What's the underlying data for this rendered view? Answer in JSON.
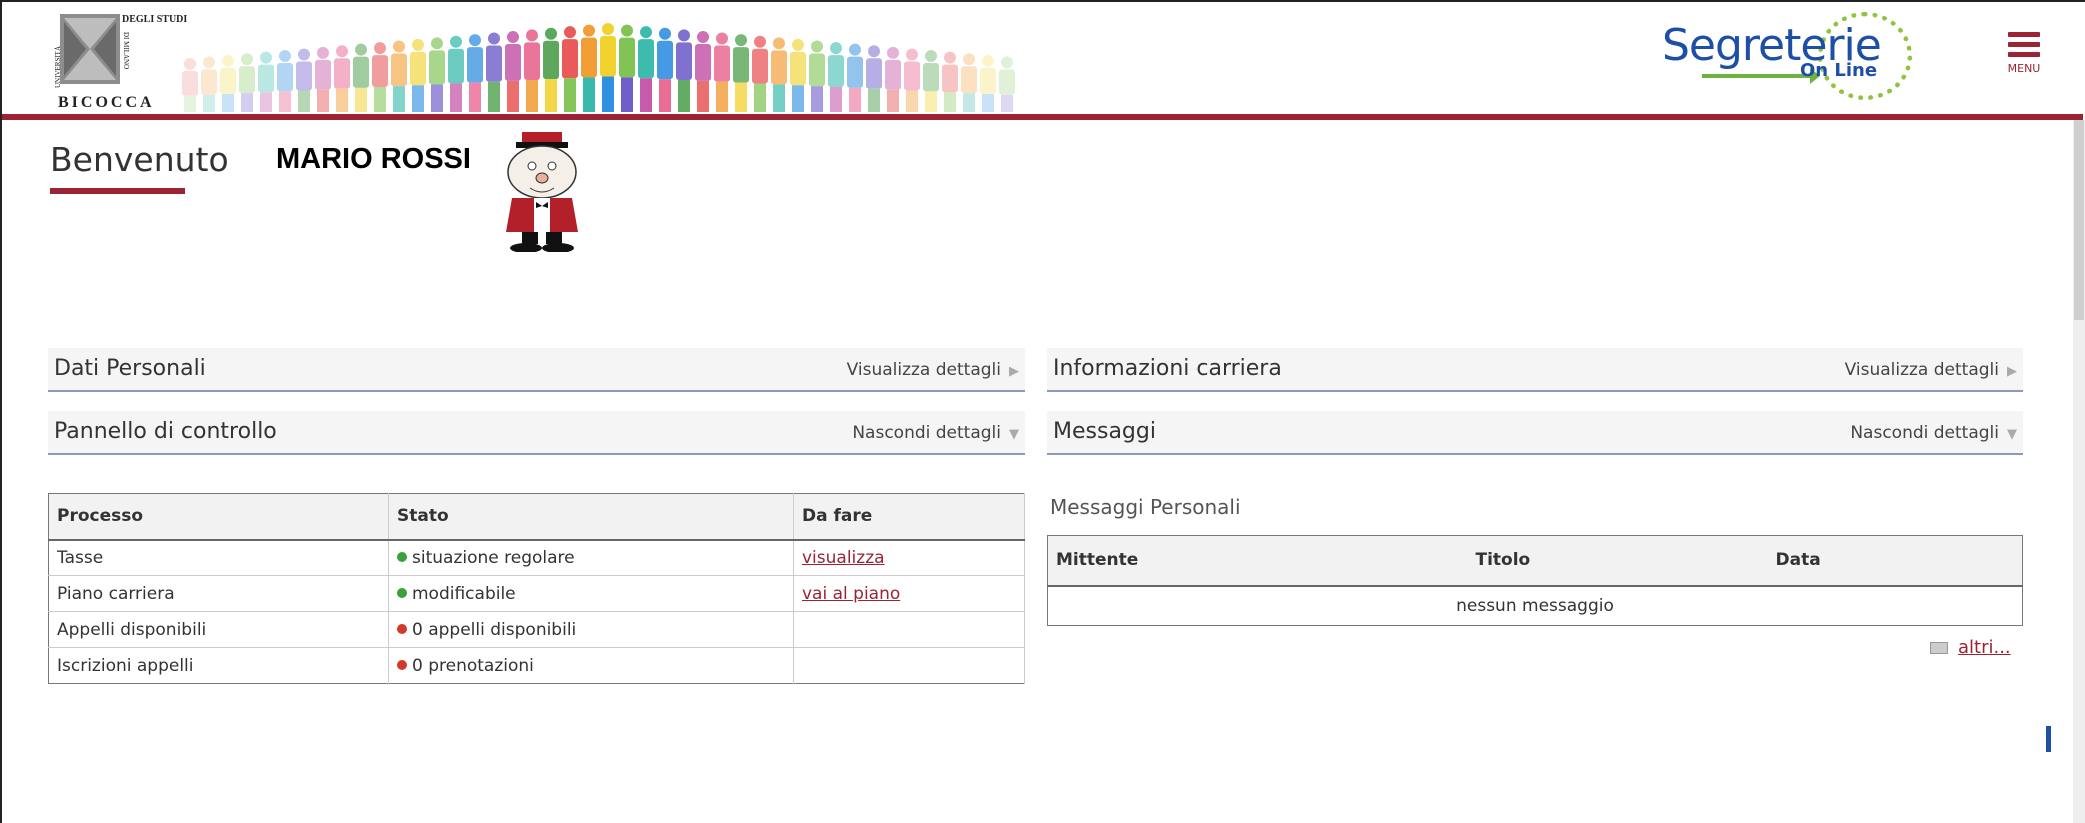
{
  "header": {
    "logo": {
      "top_text": "DEGLI STUDI",
      "vertical_left": "UNIVERSITÀ",
      "vertical_right": "DI MILANO",
      "name": "BICOCCA"
    },
    "brand": {
      "big": "Segreterie",
      "small": "On Line"
    },
    "menu_label": "MENU"
  },
  "welcome": {
    "text": "Benvenuto",
    "username": "MARIO ROSSI"
  },
  "panels": {
    "dati_personali": {
      "title": "Dati Personali",
      "action": "Visualizza dettagli"
    },
    "informazioni_carriera": {
      "title": "Informazioni carriera",
      "action": "Visualizza dettagli"
    },
    "pannello_controllo": {
      "title": "Pannello di controllo",
      "action": "Nascondi dettagli"
    },
    "messaggi": {
      "title": "Messaggi",
      "action": "Nascondi dettagli"
    }
  },
  "process_table": {
    "headers": [
      "Processo",
      "Stato",
      "Da fare"
    ],
    "rows": [
      {
        "processo": "Tasse",
        "stato": "situazione regolare",
        "status_color": "green",
        "da_fare": "visualizza"
      },
      {
        "processo": "Piano carriera",
        "stato": "modificabile",
        "status_color": "green",
        "da_fare": "vai al piano"
      },
      {
        "processo": "Appelli disponibili",
        "stato": "0 appelli disponibili",
        "status_color": "red",
        "da_fare": ""
      },
      {
        "processo": "Iscrizioni appelli",
        "stato": "0 prenotazioni",
        "status_color": "red",
        "da_fare": ""
      }
    ]
  },
  "messages": {
    "section_title": "Messaggi Personali",
    "headers": [
      "Mittente",
      "Titolo",
      "Data"
    ],
    "empty_text": "nessun messaggio",
    "more_link": "altri..."
  },
  "colors": {
    "accent": "#9b2334",
    "brand_blue": "#1c4fa5",
    "brand_green": "#6db33f",
    "status_ok": "#3aa13a",
    "status_bad": "#d03a2a"
  }
}
